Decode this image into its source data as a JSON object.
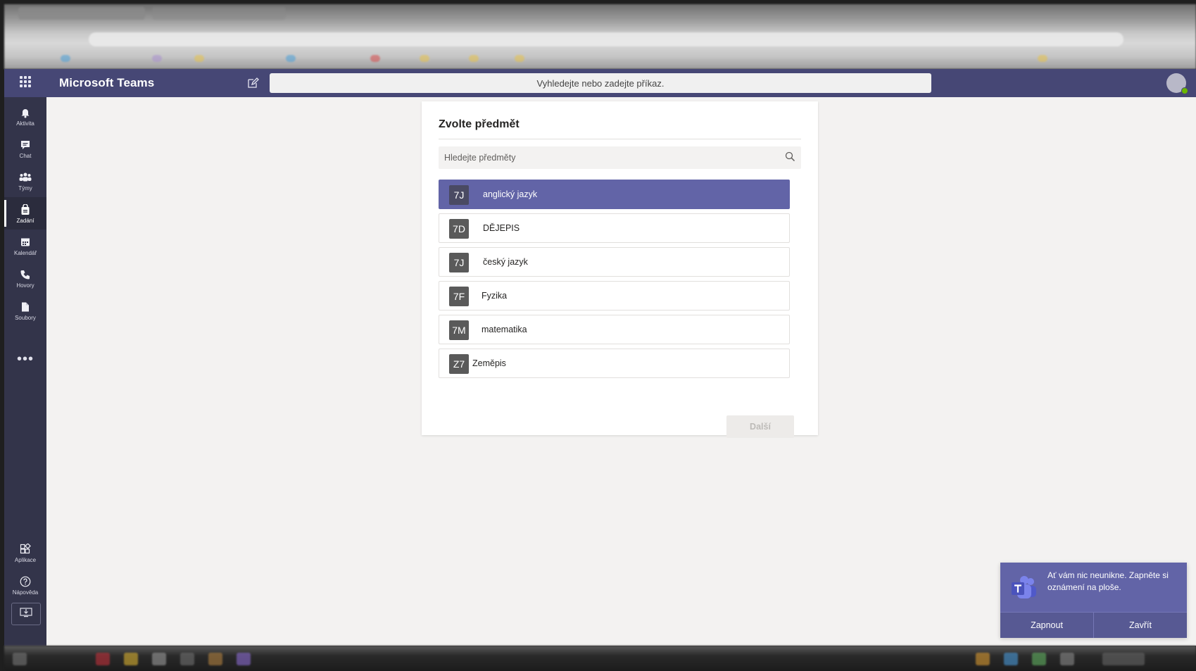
{
  "app": {
    "title": "Microsoft Teams"
  },
  "search": {
    "placeholder": "Vyhledejte nebo zadejte příkaz."
  },
  "rail": {
    "items": [
      {
        "label": "Aktivita",
        "icon": "bell-icon"
      },
      {
        "label": "Chat",
        "icon": "chat-icon"
      },
      {
        "label": "Týmy",
        "icon": "teams-icon"
      },
      {
        "label": "Zadání",
        "icon": "assignments-icon",
        "active": true
      },
      {
        "label": "Kalendář",
        "icon": "calendar-icon"
      },
      {
        "label": "Hovory",
        "icon": "phone-icon"
      },
      {
        "label": "Soubory",
        "icon": "files-icon"
      }
    ],
    "more": "•••",
    "bottom": [
      {
        "label": "Aplikace",
        "icon": "apps-icon"
      },
      {
        "label": "Nápověda",
        "icon": "help-icon"
      }
    ]
  },
  "dialog": {
    "title": "Zvolte předmět",
    "search_placeholder": "Hledejte předměty",
    "subjects": [
      {
        "badge": "7J",
        "name": "anglický jazyk",
        "selected": true
      },
      {
        "badge": "7D",
        "name": "DĚJEPIS"
      },
      {
        "badge": "7J",
        "name": "český jazyk"
      },
      {
        "badge": "7F",
        "name": "Fyzika"
      },
      {
        "badge": "7M",
        "name": "matematika"
      },
      {
        "badge": "Z7",
        "name": "Zeměpis"
      }
    ],
    "next_label": "Další"
  },
  "toast": {
    "message": "Ať vám nic neunikne. Zapněte si oznámení na ploše.",
    "enable_label": "Zapnout",
    "close_label": "Zavřít"
  },
  "colors": {
    "brand": "#464775",
    "accent": "#6264a7",
    "rail": "#33344a",
    "canvas": "#f3f2f1"
  }
}
